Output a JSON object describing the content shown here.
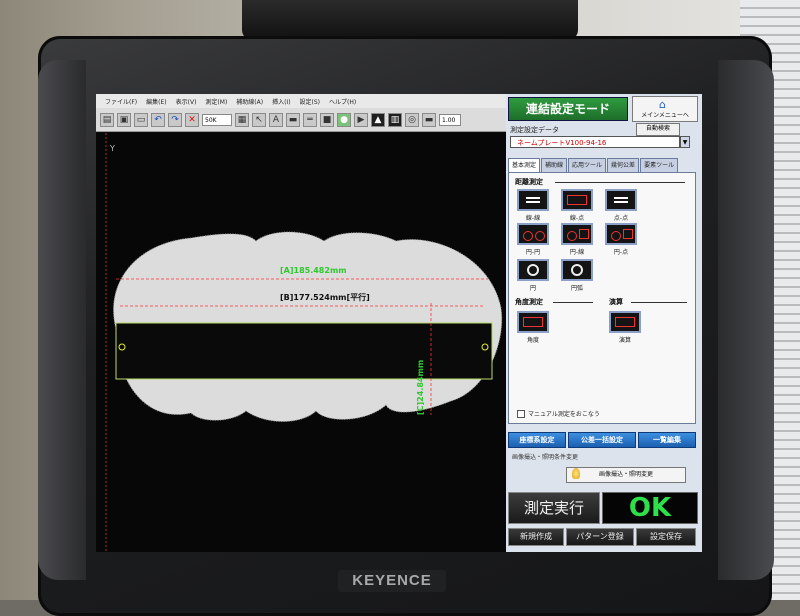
{
  "menu": [
    "ファイル(F)",
    "編集(E)",
    "表示(V)",
    "測定(M)",
    "補助線(A)",
    "挿入(I)",
    "設定(S)",
    "ヘルプ(H)"
  ],
  "toolbar": {
    "zoom": "50K",
    "scale": "1.00"
  },
  "canvas": {
    "axis_label": "Y",
    "measure_1": "[A]185.482mm",
    "measure_2": "[B]177.524mm[平行]",
    "measure_3": "[C]24.84mm",
    "colors": {
      "part": "#dcdcdc",
      "dim_line": "#ff3030",
      "text": "#2ec82e"
    }
  },
  "panel": {
    "mode_title": "連結設定モード",
    "main_menu": "メインメニューへ",
    "data_label": "測定設定データ",
    "auto_search": "自動検索",
    "data_value": "ネームプレートV100-94-16",
    "tabs": [
      "基本測定",
      "補助線",
      "応用ツール",
      "幾何公差",
      "要素ツール"
    ],
    "section_distance": "距離測定",
    "section_angle": "角度測定",
    "section_calc": "演算",
    "btn_labels": [
      "線-線",
      "線-点",
      "点-点",
      "円-円",
      "円-線",
      "円-点",
      "円",
      "円弧",
      "角度",
      "演算"
    ],
    "manual_check": "マニュアル測定をおこなう",
    "coord_btn": "座標系設定",
    "tol_btn": "公差一括設定",
    "list_btn": "一覧編集",
    "light_label": "画像撮込・照明条件変更",
    "light_btn": "画像撮込・照明変更",
    "exec_btn": "測定実行",
    "result": "OK",
    "new_btn": "新規作成",
    "pattern_btn": "パターン登録",
    "save_btn": "設定保存"
  },
  "brand": "KEYENCE"
}
